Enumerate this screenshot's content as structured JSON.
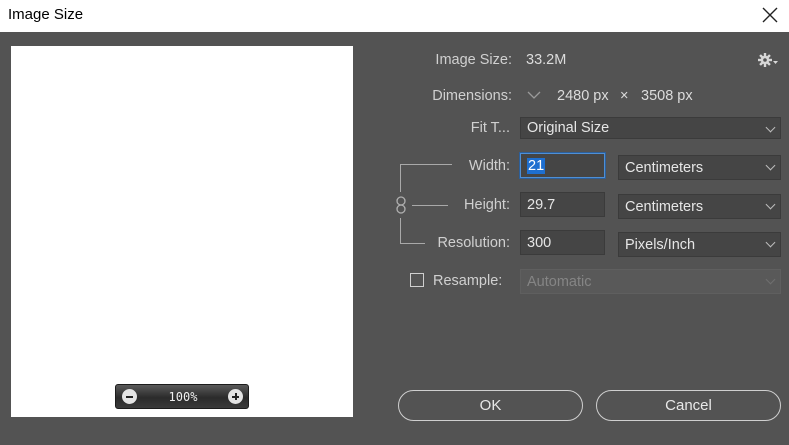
{
  "window": {
    "title": "Image Size"
  },
  "preview": {
    "zoom": "100%"
  },
  "image_size": {
    "label": "Image Size:",
    "value": "33.2M"
  },
  "dimensions": {
    "label": "Dimensions:",
    "width": "2480 px",
    "times": "×",
    "height": "3508 px"
  },
  "fit_to": {
    "label": "Fit T...",
    "value": "Original Size"
  },
  "width": {
    "label": "Width:",
    "value": "21",
    "unit": "Centimeters"
  },
  "height": {
    "label": "Height:",
    "value": "29.7",
    "unit": "Centimeters"
  },
  "resolution": {
    "label": "Resolution:",
    "value": "300",
    "unit": "Pixels/Inch"
  },
  "resample": {
    "label": "Resample:",
    "value": "Automatic",
    "checked": false
  },
  "buttons": {
    "ok": "OK",
    "cancel": "Cancel"
  },
  "icons": {
    "close": "close-icon",
    "settings": "gear-icon",
    "zoom_out": "zoom-out-icon",
    "zoom_in": "zoom-in-icon",
    "link": "chain-link-icon",
    "dimensions_toggle": "chevron-down-icon"
  },
  "colors": {
    "dialog_bg": "#535353",
    "field_bg": "#454545",
    "focus": "#4e8fd6",
    "selection": "#1e6fd0"
  }
}
